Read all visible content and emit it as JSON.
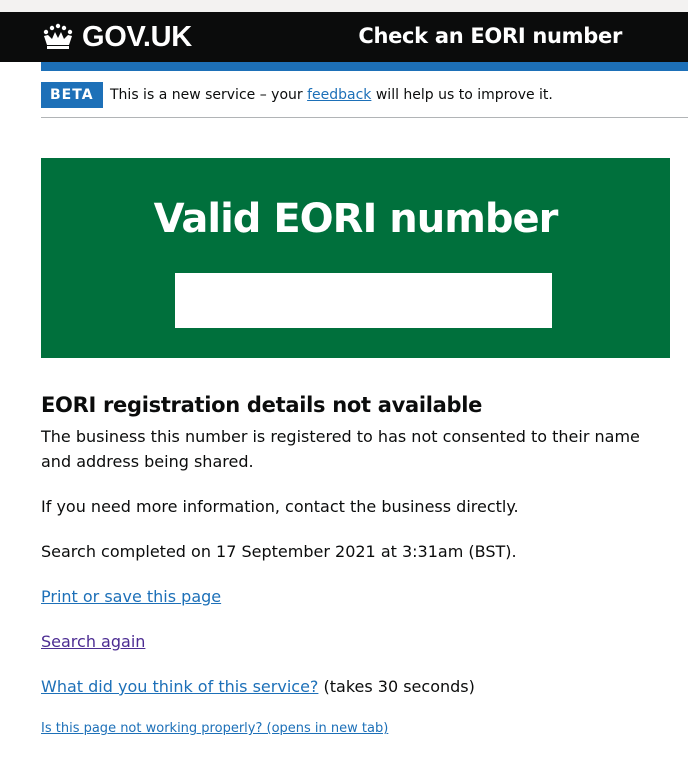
{
  "header": {
    "logo_text": "GOV.UK",
    "service_name": "Check an EORI number"
  },
  "phase_banner": {
    "tag": "BETA",
    "text_before": "This is a new service – your ",
    "link_text": "feedback",
    "text_after": " will help us to improve it."
  },
  "panel": {
    "title": "Valid EORI number",
    "eori_value": ""
  },
  "main": {
    "heading": "EORI registration details not available",
    "para1_line1": "The business this number is registered to has not consented to their name",
    "para1_line2": "and address being shared.",
    "para2": "If you need more information, contact the business directly.",
    "search_completed": "Search completed on 17 September 2021 at 3:31am (BST).",
    "print_link": "Print or save this page",
    "search_again_link": "Search again",
    "feedback_link": "What did you think of this service?",
    "feedback_suffix": " (takes 30 seconds)",
    "report_link": "Is this page not working properly? (opens in new tab)"
  },
  "colors": {
    "header_bg": "#0b0c0c",
    "brand_blue": "#1d70b8",
    "panel_green": "#00703c",
    "visited_link": "#4c2c92"
  },
  "icons": {
    "logo": "crown-icon"
  }
}
